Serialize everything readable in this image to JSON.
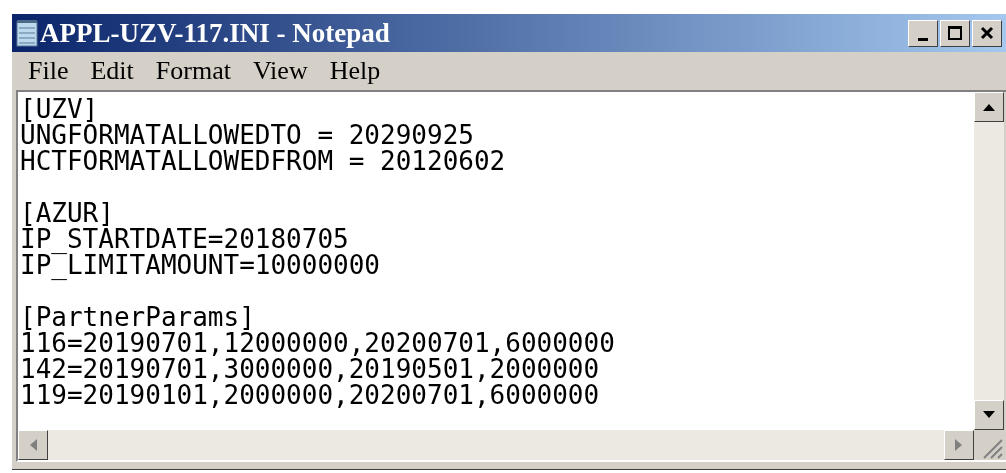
{
  "window": {
    "title": "APPL-UZV-117.INI - Notepad"
  },
  "menu": [
    "File",
    "Edit",
    "Format",
    "View",
    "Help"
  ],
  "sections": [
    {
      "header": "[UZV]",
      "lines": [
        "UNGFORMATALLOWEDTO = 20290925",
        "HCTFORMATALLOWEDFROM = 20120602"
      ]
    },
    {
      "header": "[AZUR]",
      "lines": [
        "IP_STARTDATE=20180705",
        "IP_LIMITAMOUNT=10000000"
      ]
    },
    {
      "header": "[PartnerParams]",
      "lines": [
        "116=20190701,12000000,20200701,6000000",
        "142=20190701,3000000,20190501,2000000",
        "119=20190101,2000000,20200701,6000000"
      ]
    }
  ]
}
